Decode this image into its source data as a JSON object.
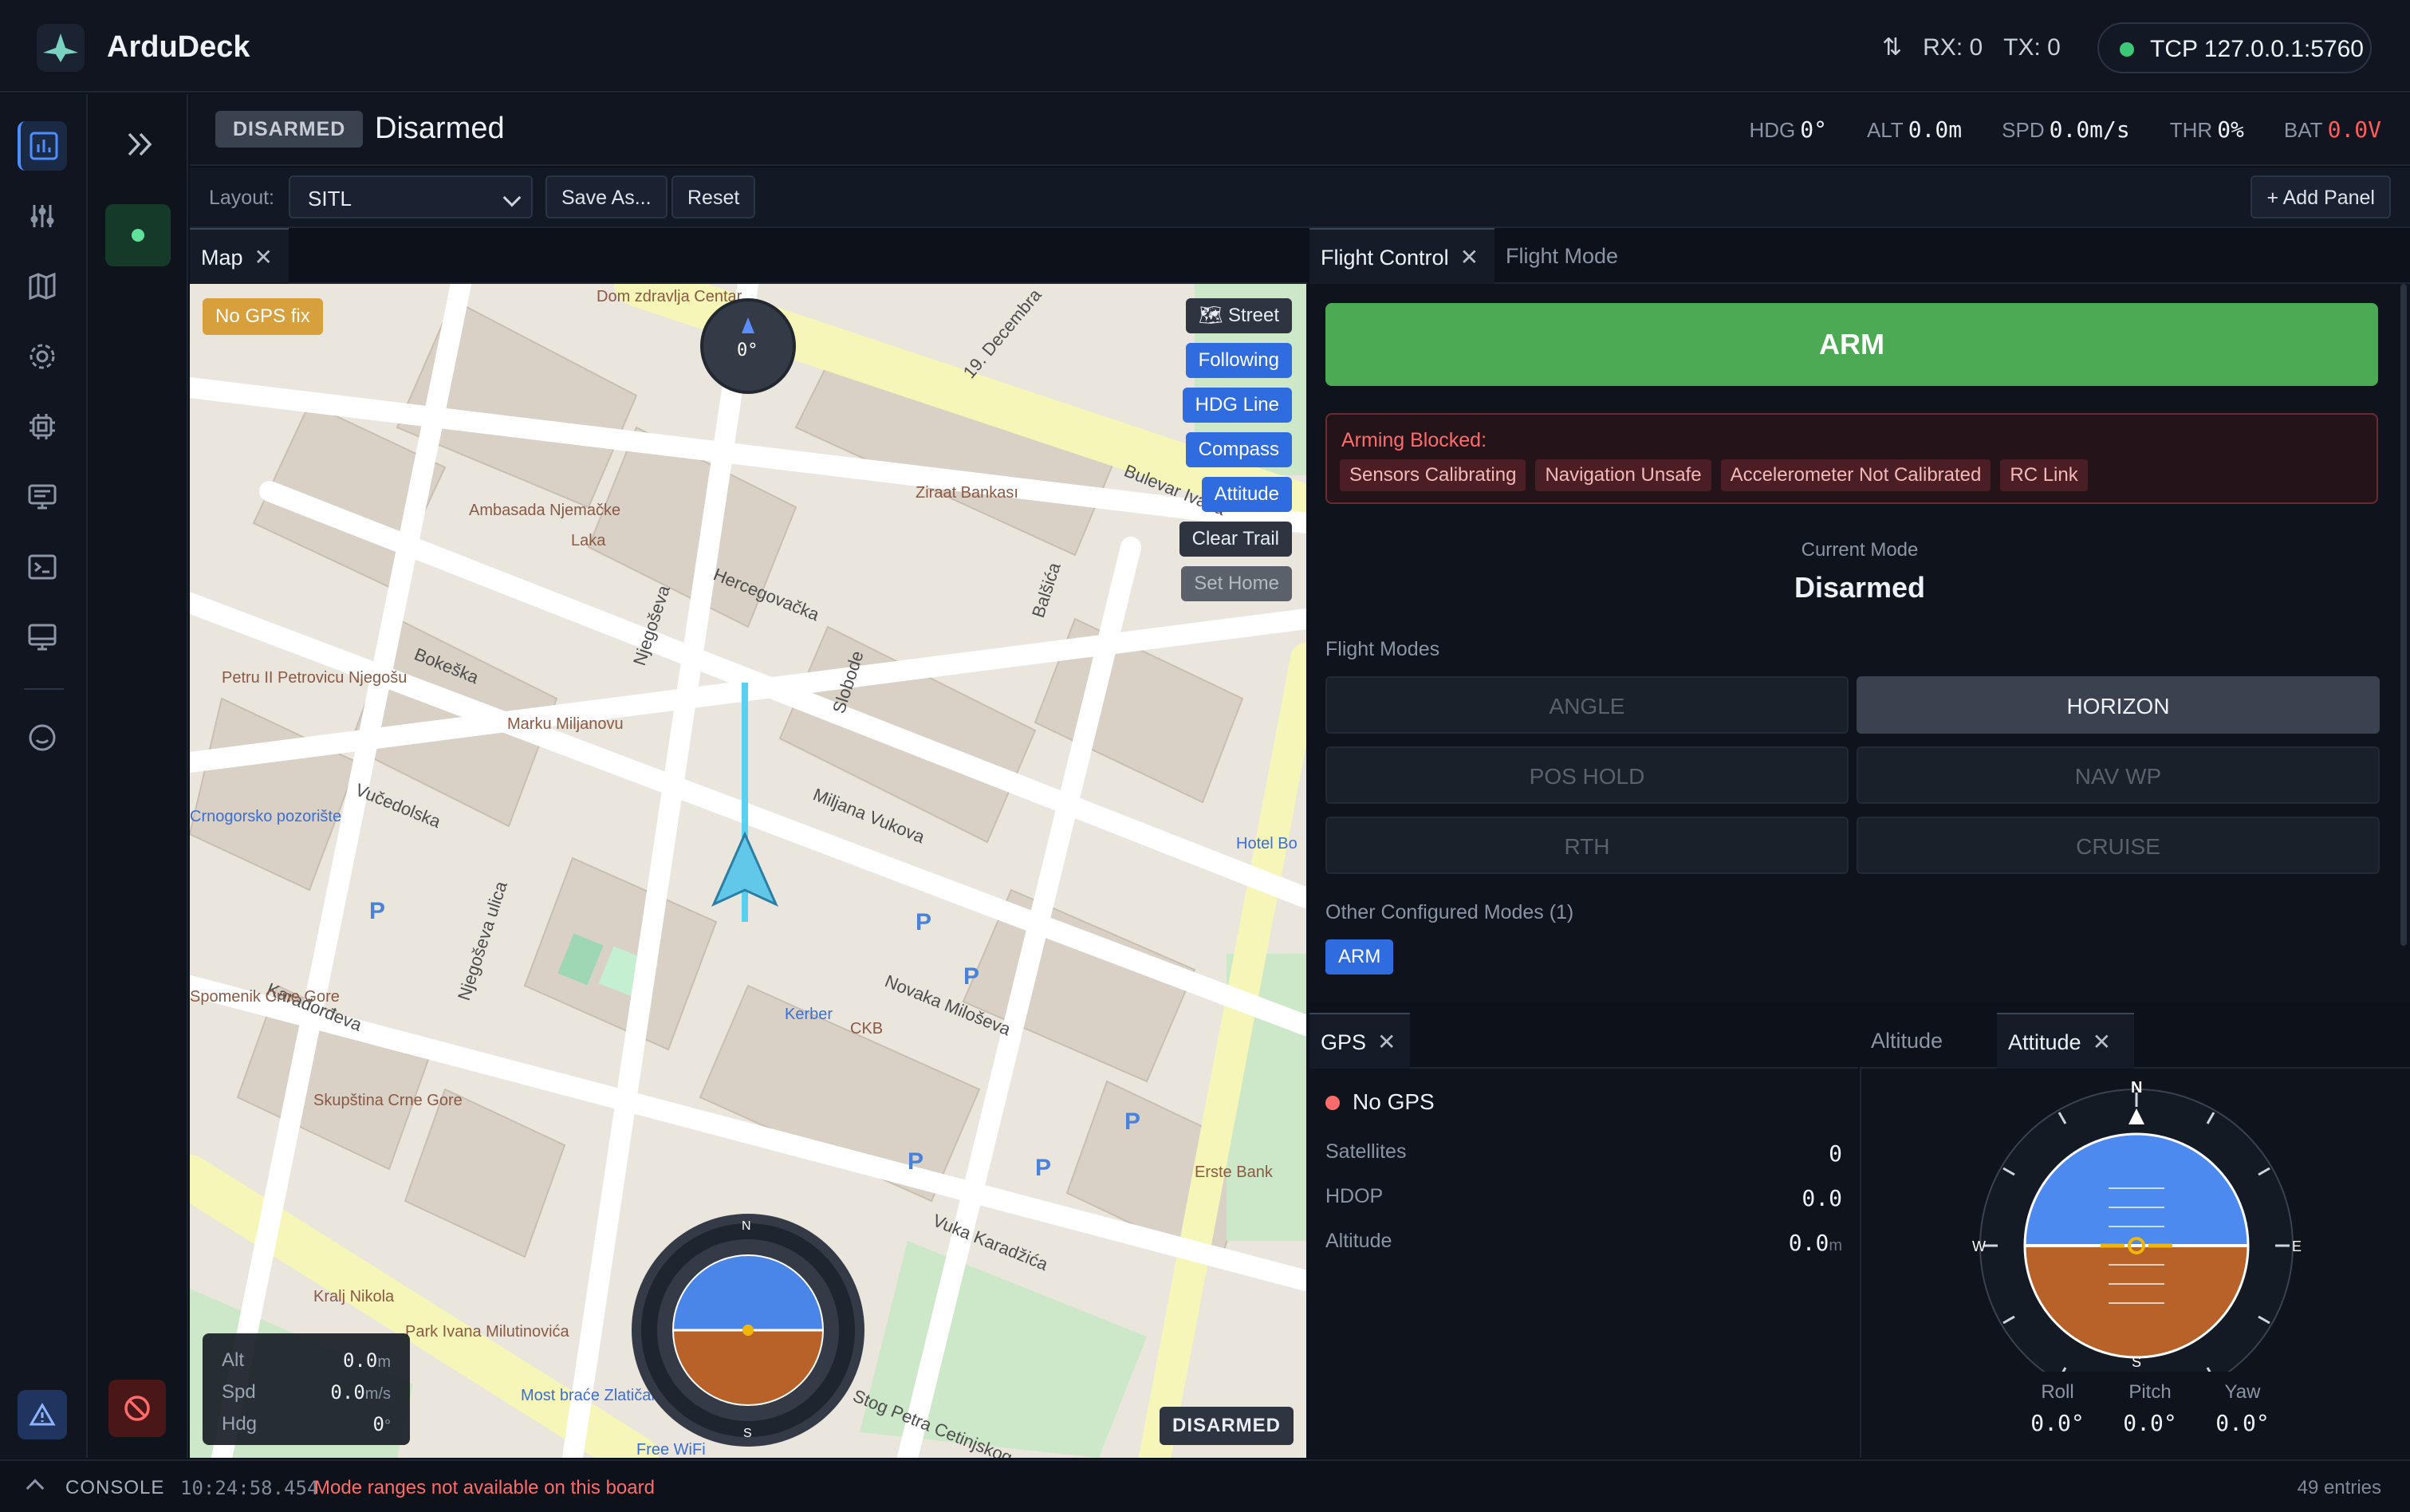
{
  "app": {
    "title": "ArduDeck"
  },
  "link": {
    "rx": "RX: 0",
    "tx": "TX: 0",
    "connection": "TCP 127.0.0.1:5760"
  },
  "status": {
    "badge": "DISARMED",
    "state": "Disarmed",
    "telemetry": [
      {
        "label": "HDG",
        "value": "0°"
      },
      {
        "label": "ALT",
        "value": "0.0m"
      },
      {
        "label": "SPD",
        "value": "0.0m/s"
      },
      {
        "label": "THR",
        "value": "0%"
      },
      {
        "label": "BAT",
        "value": "0.0V"
      }
    ]
  },
  "layout": {
    "label": "Layout:",
    "selected": "SITL",
    "save_as": "Save As...",
    "reset": "Reset",
    "add_panel": "+ Add Panel"
  },
  "map_panel": {
    "tab": "Map",
    "gps_chip": "No GPS fix",
    "buttons": [
      "Street",
      "Following",
      "HDG Line",
      "Compass",
      "Attitude",
      "Clear Trail",
      "Set Home"
    ],
    "compass_value": "0°",
    "stats": {
      "alt_label": "Alt",
      "alt_value": "0.0",
      "alt_unit": "m",
      "spd_label": "Spd",
      "spd_value": "0.0",
      "spd_unit": "m/s",
      "hdg_label": "Hdg",
      "hdg_value": "0",
      "hdg_unit": "°"
    },
    "disarmed": "DISARMED",
    "streets": [
      "Hercegovačka",
      "Bokeška",
      "Vučedolska",
      "Slobode",
      "Njegoševa",
      "Miljana Vukova",
      "Novaka Miloševa",
      "Balšića",
      "Bulevar Ivana",
      "19. Decembra",
      "Vuka Karadžića",
      "Karađorđeva",
      "Stog Petra Cetinjskog",
      "Njegoševa ulica"
    ],
    "places": [
      "Dom zdravlja Centar",
      "Ziraat Bankası",
      "Ambasada Njemačke",
      "Laka",
      "Petru II Petrovicu Njegošu",
      "Marku Miljanovu",
      "Hotel Bo",
      "Kerber",
      "CKB",
      "Erste Bank",
      "Skupština Crne Gore",
      "Kralj Nikola",
      "Park Ivana Milutinovića",
      "Most braće Zlatičanin",
      "Free WiFi",
      "Crnogorsko pozorište",
      "Spomenik Crne Gore"
    ]
  },
  "fc_panel": {
    "tabs": [
      "Flight Control",
      "Flight Mode"
    ],
    "arm_label": "ARM",
    "arming_title": "Arming Blocked:",
    "arming_reasons": [
      "Sensors Calibrating",
      "Navigation Unsafe",
      "Accelerometer Not Calibrated",
      "RC Link"
    ],
    "current_mode_label": "Current Mode",
    "current_mode": "Disarmed",
    "modes_label": "Flight Modes",
    "modes": [
      "ANGLE",
      "HORIZON",
      "POS HOLD",
      "NAV WP",
      "RTH",
      "CRUISE"
    ],
    "other_label": "Other Configured Modes (1)",
    "other_modes": [
      "ARM"
    ]
  },
  "gps_panel": {
    "tab": "GPS",
    "status": "No GPS",
    "satellites_label": "Satellites",
    "satellites": "0",
    "hdop_label": "HDOP",
    "hdop": "0.0",
    "altitude_label": "Altitude",
    "altitude": "0.0",
    "altitude_unit": "m"
  },
  "att_panel": {
    "tabs": [
      "Altitude",
      "Attitude"
    ],
    "roll_label": "Roll",
    "roll": "0.0°",
    "pitch_label": "Pitch",
    "pitch": "0.0°",
    "yaw_label": "Yaw",
    "yaw": "0.0°"
  },
  "console": {
    "label": "CONSOLE",
    "time": "10:24:58.454",
    "message": "Mode ranges not available on this board",
    "count": "49 entries"
  }
}
